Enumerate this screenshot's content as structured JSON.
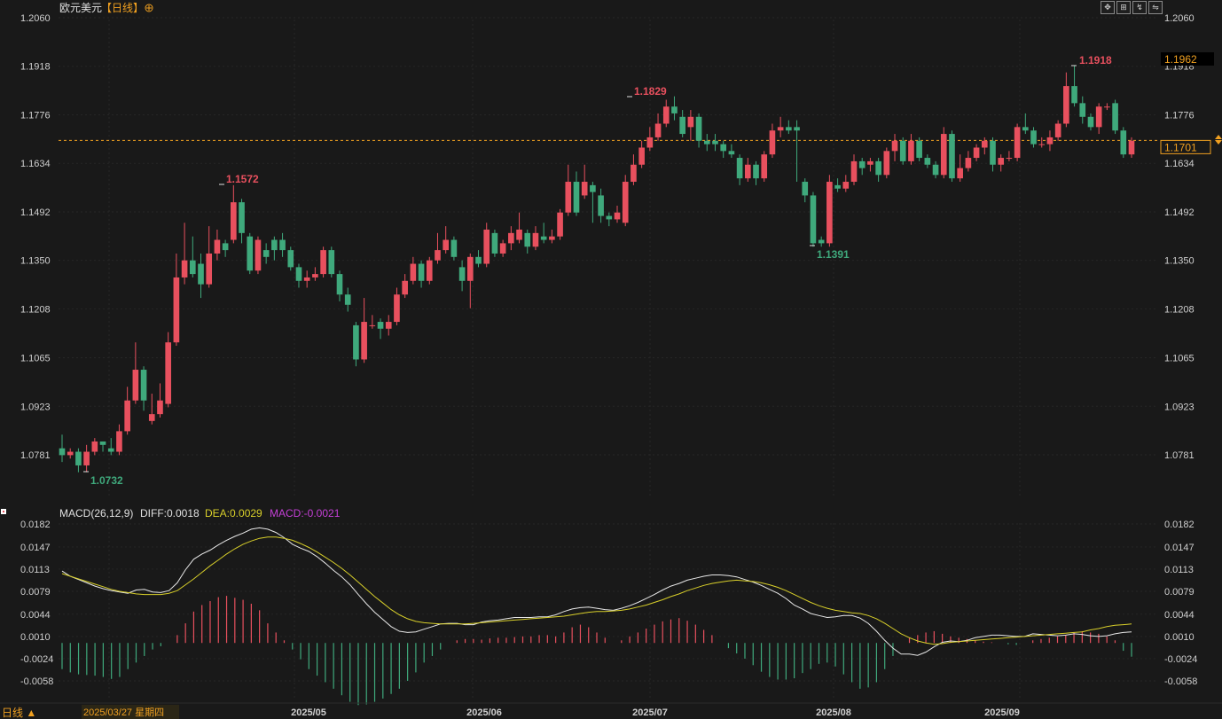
{
  "title": {
    "symbol": "欧元美元",
    "period": "【日线】",
    "add_icon": "plus-circle-icon"
  },
  "toolbar": [
    "fullscreen-icon",
    "table-icon",
    "chart-icon",
    "switch-icon"
  ],
  "price_axis": {
    "ticks": [
      "1.2060",
      "1.1918",
      "1.1776",
      "1.1634",
      "1.1492",
      "1.1350",
      "1.1208",
      "1.1065",
      "1.0923",
      "1.0781"
    ],
    "latest_price": "1.1701",
    "cursor_price": "1.1962"
  },
  "annotations": {
    "high_1": "1.1572",
    "high_2": "1.1829",
    "high_3": "1.1918",
    "low_1": "1.0732",
    "low_2": "1.1391"
  },
  "macd": {
    "params": "MACD(26,12,9)",
    "diff": "DIFF:0.0018",
    "dea": "DEA:0.0029",
    "macd": "MACD:-0.0021",
    "ticks": [
      "0.0182",
      "0.0147",
      "0.0113",
      "0.0079",
      "0.0044",
      "0.0010",
      "-0.0024",
      "-0.0058"
    ]
  },
  "x_axis": {
    "period_toggle": "日线 ▲",
    "cursor_date": "2025/03/27 星期四",
    "months": [
      "2025/05",
      "2025/06",
      "2025/07",
      "2025/08",
      "2025/09"
    ]
  },
  "colors": {
    "up": "#e8505e",
    "down": "#3fa97c",
    "diff_line": "#e8e8e8",
    "dea_line": "#d8cf2a",
    "macd_label": "#c43fd6",
    "accent": "#f0a020"
  },
  "chart_data": [
    {
      "type": "candlestick",
      "title": "欧元美元",
      "period": "日线",
      "x_range": [
        "2025-03-27",
        "2025-09-24"
      ],
      "ylim": [
        1.0781,
        1.206
      ],
      "latest_close": 1.1701,
      "ohlc": [
        [
          1.08,
          1.078,
          1.084,
          1.076
        ],
        [
          1.078,
          1.079,
          1.08,
          1.077
        ],
        [
          1.079,
          1.075,
          1.08,
          1.073
        ],
        [
          1.075,
          1.079,
          1.081,
          1.073
        ],
        [
          1.079,
          1.082,
          1.083,
          1.078
        ],
        [
          1.082,
          1.081,
          1.082,
          1.079
        ],
        [
          1.08,
          1.079,
          1.083,
          1.078
        ],
        [
          1.079,
          1.085,
          1.087,
          1.078
        ],
        [
          1.085,
          1.094,
          1.098,
          1.084
        ],
        [
          1.094,
          1.103,
          1.111,
          1.093
        ],
        [
          1.103,
          1.094,
          1.104,
          1.091
        ],
        [
          1.088,
          1.09,
          1.096,
          1.087
        ],
        [
          1.09,
          1.094,
          1.099,
          1.089
        ],
        [
          1.093,
          1.111,
          1.114,
          1.092
        ],
        [
          1.111,
          1.13,
          1.137,
          1.11
        ],
        [
          1.13,
          1.135,
          1.146,
          1.128
        ],
        [
          1.135,
          1.131,
          1.142,
          1.13
        ],
        [
          1.134,
          1.128,
          1.137,
          1.124
        ],
        [
          1.128,
          1.137,
          1.145,
          1.127
        ],
        [
          1.137,
          1.141,
          1.144,
          1.135
        ],
        [
          1.14,
          1.138,
          1.141,
          1.136
        ],
        [
          1.141,
          1.152,
          1.157,
          1.14
        ],
        [
          1.152,
          1.143,
          1.153,
          1.14
        ],
        [
          1.142,
          1.132,
          1.143,
          1.131
        ],
        [
          1.132,
          1.141,
          1.142,
          1.131
        ],
        [
          1.138,
          1.136,
          1.14,
          1.134
        ],
        [
          1.141,
          1.138,
          1.142,
          1.135
        ],
        [
          1.141,
          1.138,
          1.143,
          1.136
        ],
        [
          1.138,
          1.133,
          1.139,
          1.132
        ],
        [
          1.133,
          1.129,
          1.134,
          1.127
        ],
        [
          1.129,
          1.13,
          1.132,
          1.127
        ],
        [
          1.13,
          1.131,
          1.133,
          1.129
        ],
        [
          1.131,
          1.138,
          1.139,
          1.13
        ],
        [
          1.138,
          1.131,
          1.139,
          1.13
        ],
        [
          1.131,
          1.125,
          1.132,
          1.123
        ],
        [
          1.125,
          1.122,
          1.127,
          1.12
        ],
        [
          1.116,
          1.106,
          1.117,
          1.104
        ],
        [
          1.106,
          1.117,
          1.124,
          1.105
        ],
        [
          1.116,
          1.116,
          1.119,
          1.115
        ],
        [
          1.117,
          1.115,
          1.118,
          1.112
        ],
        [
          1.115,
          1.117,
          1.119,
          1.113
        ],
        [
          1.117,
          1.125,
          1.127,
          1.116
        ],
        [
          1.125,
          1.129,
          1.131,
          1.124
        ],
        [
          1.129,
          1.134,
          1.136,
          1.128
        ],
        [
          1.134,
          1.129,
          1.135,
          1.127
        ],
        [
          1.129,
          1.135,
          1.136,
          1.128
        ],
        [
          1.135,
          1.138,
          1.143,
          1.134
        ],
        [
          1.138,
          1.141,
          1.145,
          1.137
        ],
        [
          1.141,
          1.136,
          1.142,
          1.135
        ],
        [
          1.133,
          1.129,
          1.135,
          1.126
        ],
        [
          1.129,
          1.136,
          1.137,
          1.121
        ],
        [
          1.136,
          1.134,
          1.138,
          1.133
        ],
        [
          1.134,
          1.144,
          1.146,
          1.133
        ],
        [
          1.143,
          1.137,
          1.144,
          1.136
        ],
        [
          1.137,
          1.14,
          1.141,
          1.136
        ],
        [
          1.14,
          1.143,
          1.145,
          1.138
        ],
        [
          1.141,
          1.144,
          1.149,
          1.14
        ],
        [
          1.143,
          1.139,
          1.144,
          1.137
        ],
        [
          1.139,
          1.143,
          1.145,
          1.138
        ],
        [
          1.142,
          1.141,
          1.146,
          1.14
        ],
        [
          1.141,
          1.142,
          1.144,
          1.14
        ],
        [
          1.142,
          1.149,
          1.15,
          1.141
        ],
        [
          1.149,
          1.158,
          1.163,
          1.148
        ],
        [
          1.158,
          1.149,
          1.161,
          1.148
        ],
        [
          1.154,
          1.158,
          1.163,
          1.153
        ],
        [
          1.157,
          1.155,
          1.158,
          1.146
        ],
        [
          1.154,
          1.148,
          1.156,
          1.146
        ],
        [
          1.148,
          1.147,
          1.149,
          1.145
        ],
        [
          1.147,
          1.149,
          1.151,
          1.146
        ],
        [
          1.146,
          1.158,
          1.16,
          1.145
        ],
        [
          1.158,
          1.163,
          1.166,
          1.157
        ],
        [
          1.163,
          1.168,
          1.17,
          1.162
        ],
        [
          1.168,
          1.171,
          1.174,
          1.167
        ],
        [
          1.171,
          1.175,
          1.178,
          1.17
        ],
        [
          1.175,
          1.18,
          1.182,
          1.174
        ],
        [
          1.18,
          1.178,
          1.183,
          1.176
        ],
        [
          1.177,
          1.172,
          1.179,
          1.171
        ],
        [
          1.174,
          1.177,
          1.179,
          1.17
        ],
        [
          1.177,
          1.17,
          1.178,
          1.168
        ],
        [
          1.17,
          1.169,
          1.172,
          1.167
        ],
        [
          1.17,
          1.169,
          1.172,
          1.167
        ],
        [
          1.169,
          1.167,
          1.17,
          1.165
        ],
        [
          1.167,
          1.166,
          1.169,
          1.165
        ],
        [
          1.165,
          1.159,
          1.166,
          1.157
        ],
        [
          1.159,
          1.163,
          1.165,
          1.158
        ],
        [
          1.163,
          1.159,
          1.164,
          1.157
        ],
        [
          1.159,
          1.166,
          1.167,
          1.158
        ],
        [
          1.166,
          1.173,
          1.175,
          1.165
        ],
        [
          1.173,
          1.174,
          1.177,
          1.171
        ],
        [
          1.174,
          1.173,
          1.176,
          1.172
        ],
        [
          1.174,
          1.173,
          1.176,
          1.158
        ],
        [
          1.158,
          1.154,
          1.159,
          1.152
        ],
        [
          1.154,
          1.14,
          1.155,
          1.139
        ],
        [
          1.141,
          1.14,
          1.142,
          1.139
        ],
        [
          1.14,
          1.158,
          1.16,
          1.139
        ],
        [
          1.157,
          1.156,
          1.159,
          1.155
        ],
        [
          1.156,
          1.158,
          1.16,
          1.155
        ],
        [
          1.158,
          1.164,
          1.166,
          1.157
        ],
        [
          1.164,
          1.162,
          1.165,
          1.16
        ],
        [
          1.163,
          1.164,
          1.165,
          1.161
        ],
        [
          1.164,
          1.16,
          1.165,
          1.158
        ],
        [
          1.16,
          1.167,
          1.168,
          1.159
        ],
        [
          1.167,
          1.17,
          1.172,
          1.164
        ],
        [
          1.17,
          1.164,
          1.171,
          1.163
        ],
        [
          1.164,
          1.17,
          1.172,
          1.163
        ],
        [
          1.17,
          1.165,
          1.171,
          1.164
        ],
        [
          1.165,
          1.163,
          1.166,
          1.162
        ],
        [
          1.163,
          1.16,
          1.164,
          1.159
        ],
        [
          1.16,
          1.172,
          1.174,
          1.159
        ],
        [
          1.172,
          1.159,
          1.173,
          1.158
        ],
        [
          1.159,
          1.162,
          1.166,
          1.158
        ],
        [
          1.162,
          1.165,
          1.167,
          1.161
        ],
        [
          1.165,
          1.168,
          1.169,
          1.164
        ],
        [
          1.168,
          1.17,
          1.171,
          1.166
        ],
        [
          1.17,
          1.163,
          1.171,
          1.161
        ],
        [
          1.163,
          1.165,
          1.166,
          1.161
        ],
        [
          1.165,
          1.165,
          1.167,
          1.164
        ],
        [
          1.165,
          1.174,
          1.175,
          1.164
        ],
        [
          1.174,
          1.173,
          1.178,
          1.172
        ],
        [
          1.173,
          1.169,
          1.174,
          1.168
        ],
        [
          1.169,
          1.169,
          1.171,
          1.168
        ],
        [
          1.169,
          1.171,
          1.173,
          1.167
        ],
        [
          1.171,
          1.175,
          1.176,
          1.17
        ],
        [
          1.175,
          1.186,
          1.19,
          1.174
        ],
        [
          1.186,
          1.181,
          1.192,
          1.18
        ],
        [
          1.181,
          1.177,
          1.183,
          1.175
        ],
        [
          1.177,
          1.174,
          1.178,
          1.173
        ],
        [
          1.174,
          1.18,
          1.181,
          1.172
        ],
        [
          1.18,
          1.18,
          1.181,
          1.179
        ],
        [
          1.181,
          1.173,
          1.182,
          1.172
        ],
        [
          1.173,
          1.166,
          1.174,
          1.165
        ],
        [
          1.166,
          1.17,
          1.171,
          1.165
        ]
      ]
    },
    {
      "type": "macd",
      "title": "MACD(26,12,9)",
      "ylim": [
        -0.0058,
        0.0182
      ],
      "diff": [
        0.011,
        0.0102,
        0.0097,
        0.0092,
        0.0087,
        0.0083,
        0.008,
        0.0078,
        0.0076,
        0.0081,
        0.0082,
        0.0078,
        0.0077,
        0.008,
        0.0092,
        0.0112,
        0.0128,
        0.0136,
        0.0142,
        0.015,
        0.0157,
        0.0163,
        0.0168,
        0.0174,
        0.0176,
        0.0174,
        0.0169,
        0.0161,
        0.0151,
        0.0145,
        0.014,
        0.0132,
        0.0122,
        0.0111,
        0.0101,
        0.0089,
        0.0074,
        0.006,
        0.0047,
        0.0036,
        0.0025,
        0.0018,
        0.0016,
        0.0017,
        0.0021,
        0.0025,
        0.0029,
        0.003,
        0.003,
        0.0028,
        0.0028,
        0.0032,
        0.0034,
        0.0035,
        0.0037,
        0.0039,
        0.0039,
        0.0039,
        0.004,
        0.004,
        0.0043,
        0.0048,
        0.0052,
        0.0054,
        0.0055,
        0.0053,
        0.0051,
        0.005,
        0.0053,
        0.0057,
        0.0062,
        0.0068,
        0.0074,
        0.0081,
        0.0087,
        0.0091,
        0.0096,
        0.0099,
        0.0102,
        0.0104,
        0.0104,
        0.0103,
        0.0101,
        0.0097,
        0.0093,
        0.0088,
        0.0082,
        0.0076,
        0.0068,
        0.0058,
        0.0052,
        0.0045,
        0.0042,
        0.0039,
        0.004,
        0.0042,
        0.0042,
        0.0038,
        0.003,
        0.0018,
        0.0004,
        -0.0008,
        -0.0017,
        -0.0017,
        -0.0019,
        -0.0014,
        -0.0006,
        0.0001,
        0.0003,
        0.0002,
        0.0004,
        0.0008,
        0.001,
        0.0012,
        0.0012,
        0.0011,
        0.001,
        0.001,
        0.0014,
        0.0013,
        0.0012,
        0.0011,
        0.0012,
        0.0014,
        0.0013,
        0.0011,
        0.001,
        0.0011,
        0.0014,
        0.0016,
        0.0017
      ],
      "dea": [
        0.0106,
        0.0102,
        0.0098,
        0.0094,
        0.009,
        0.0086,
        0.0082,
        0.0079,
        0.0077,
        0.0075,
        0.0074,
        0.0074,
        0.0074,
        0.0076,
        0.008,
        0.0089,
        0.0098,
        0.0108,
        0.0118,
        0.0127,
        0.0136,
        0.0144,
        0.0151,
        0.0156,
        0.016,
        0.0162,
        0.0162,
        0.016,
        0.0157,
        0.0152,
        0.0146,
        0.0139,
        0.0131,
        0.0123,
        0.0114,
        0.0104,
        0.0093,
        0.0082,
        0.0071,
        0.0061,
        0.0051,
        0.0043,
        0.0037,
        0.0033,
        0.0031,
        0.003,
        0.0029,
        0.0029,
        0.0029,
        0.0029,
        0.003,
        0.0031,
        0.0032,
        0.0033,
        0.0034,
        0.0035,
        0.0036,
        0.0037,
        0.0038,
        0.0039,
        0.004,
        0.0041,
        0.0043,
        0.0045,
        0.0047,
        0.0048,
        0.0048,
        0.0049,
        0.005,
        0.0052,
        0.0055,
        0.0058,
        0.0062,
        0.0066,
        0.0071,
        0.0075,
        0.008,
        0.0084,
        0.0088,
        0.0091,
        0.0093,
        0.0095,
        0.0096,
        0.0095,
        0.0094,
        0.0092,
        0.0089,
        0.0085,
        0.008,
        0.0074,
        0.0068,
        0.0062,
        0.0057,
        0.0053,
        0.005,
        0.0048,
        0.0046,
        0.0045,
        0.0042,
        0.0037,
        0.003,
        0.0022,
        0.0014,
        0.0008,
        0.0003,
        0.0,
        -0.0002,
        -0.0001,
        0.0001,
        0.0002,
        0.0003,
        0.0004,
        0.0005,
        0.0006,
        0.0007,
        0.0008,
        0.0009,
        0.001,
        0.0011,
        0.0012,
        0.0013,
        0.0014,
        0.0015,
        0.0016,
        0.0017,
        0.002,
        0.0022,
        0.0025,
        0.0027,
        0.0028,
        0.0029
      ],
      "histogram": [
        -0.004,
        -0.0045,
        -0.0048,
        -0.0049,
        -0.005,
        -0.0052,
        -0.0055,
        -0.0052,
        -0.004,
        -0.003,
        -0.002,
        -0.001,
        -0.0005,
        0.0,
        0.0012,
        0.003,
        0.0048,
        0.0058,
        0.0064,
        0.007,
        0.0072,
        0.0069,
        0.0066,
        0.006,
        0.005,
        0.003,
        0.0016,
        0.0004,
        -0.001,
        -0.0025,
        -0.004,
        -0.005,
        -0.006,
        -0.007,
        -0.008,
        -0.009,
        -0.0095,
        -0.0094,
        -0.009,
        -0.0085,
        -0.0078,
        -0.007,
        -0.0058,
        -0.0045,
        -0.003,
        -0.002,
        -0.001,
        0.0,
        0.0004,
        0.0006,
        0.0006,
        0.0005,
        0.0007,
        0.0008,
        0.0008,
        0.0009,
        0.001,
        0.001,
        0.0012,
        0.0012,
        0.001,
        0.0016,
        0.0024,
        0.0028,
        0.0024,
        0.0016,
        0.0008,
        0.0,
        0.0004,
        0.001,
        0.0016,
        0.0022,
        0.0028,
        0.0033,
        0.0036,
        0.0038,
        0.0034,
        0.0028,
        0.002,
        0.0012,
        0.0,
        -0.0008,
        -0.0016,
        -0.0024,
        -0.0034,
        -0.0044,
        -0.0052,
        -0.0056,
        -0.0056,
        -0.0054,
        -0.0046,
        -0.004,
        -0.0032,
        -0.003,
        -0.0036,
        -0.0048,
        -0.006,
        -0.007,
        -0.0068,
        -0.006,
        -0.004,
        -0.002,
        0.0,
        0.0008,
        0.0012,
        0.0016,
        0.0018,
        0.0014,
        0.001,
        0.0008,
        0.0006,
        0.0004,
        0.0002,
        0.0001,
        0.0,
        -0.0002,
        -0.0003,
        0.0,
        0.0004,
        0.0006,
        0.0008,
        0.001,
        0.0012,
        0.0016,
        0.0018,
        0.0016,
        0.0014,
        0.001,
        0.0004,
        -0.0012,
        -0.0021
      ]
    }
  ]
}
